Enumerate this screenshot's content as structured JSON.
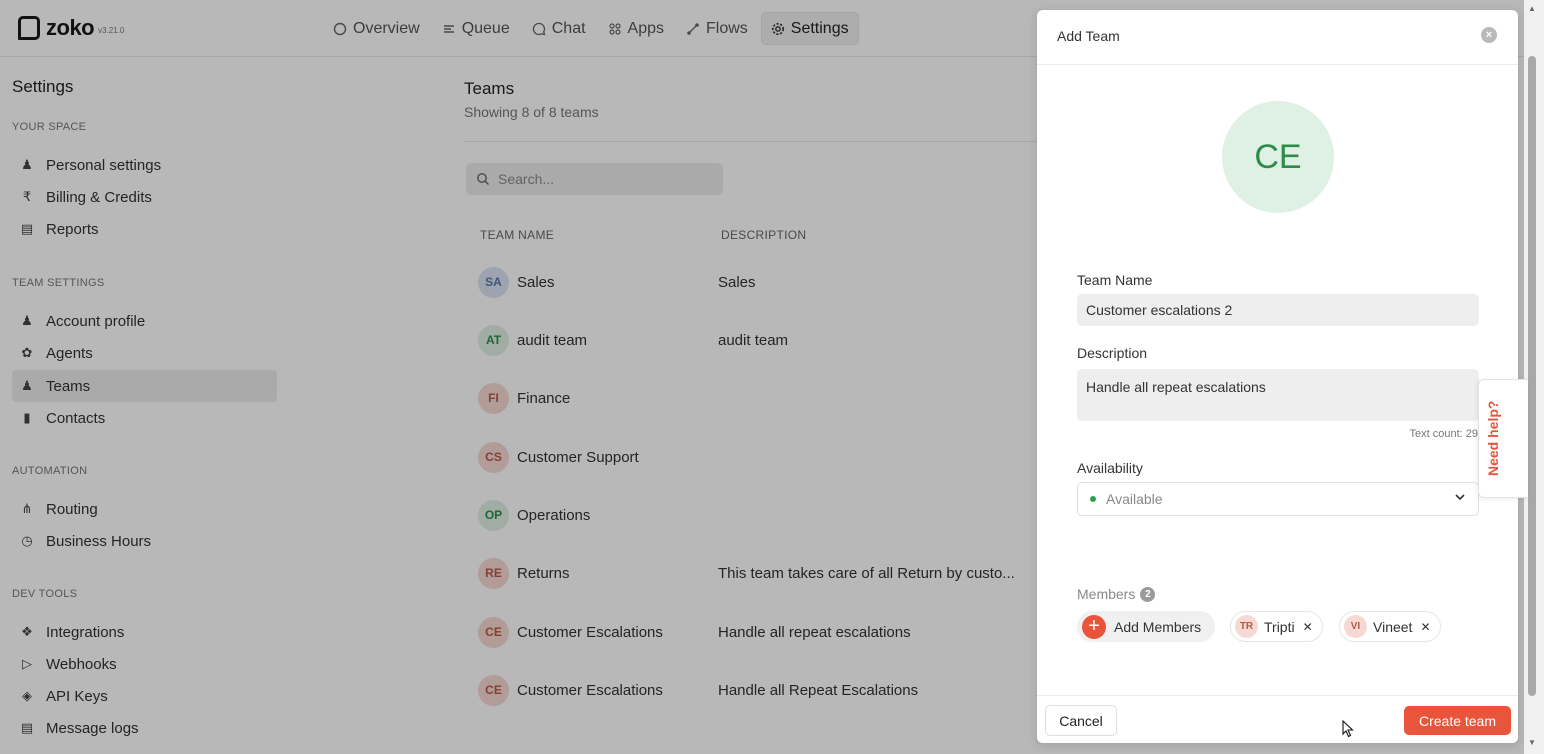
{
  "brand": {
    "name": "zoko",
    "version": "v3.21.0"
  },
  "nav": [
    {
      "label": "Overview",
      "icon": "circle-icon"
    },
    {
      "label": "Queue",
      "icon": "list-icon"
    },
    {
      "label": "Chat",
      "icon": "chat-icon"
    },
    {
      "label": "Apps",
      "icon": "grid-icon"
    },
    {
      "label": "Flows",
      "icon": "flow-icon"
    },
    {
      "label": "Settings",
      "icon": "gear-icon",
      "active": true
    }
  ],
  "sidebar": {
    "title": "Settings",
    "sections": {
      "your_space": "YOUR SPACE",
      "team_settings": "TEAM SETTINGS",
      "automation": "AUTOMATION",
      "dev_tools": "DEV TOOLS"
    },
    "items": {
      "personal": "Personal settings",
      "billing": "Billing & Credits",
      "reports": "Reports",
      "account": "Account profile",
      "agents": "Agents",
      "teams": "Teams",
      "contacts": "Contacts",
      "routing": "Routing",
      "hours": "Business Hours",
      "integrations": "Integrations",
      "webhooks": "Webhooks",
      "api": "API Keys",
      "logs": "Message logs"
    }
  },
  "teams": {
    "title": "Teams",
    "subtitle": "Showing 8 of 8 teams",
    "search_placeholder": "Search...",
    "columns": {
      "name": "TEAM NAME",
      "description": "DESCRIPTION"
    },
    "rows": [
      {
        "initials": "SA",
        "name": "Sales",
        "description": "Sales"
      },
      {
        "initials": "AT",
        "name": "audit team",
        "description": "audit team"
      },
      {
        "initials": "FI",
        "name": "Finance",
        "description": ""
      },
      {
        "initials": "CS",
        "name": "Customer Support",
        "description": ""
      },
      {
        "initials": "OP",
        "name": "Operations",
        "description": ""
      },
      {
        "initials": "RE",
        "name": "Returns",
        "description": "This team takes care of all Return by custo..."
      },
      {
        "initials": "CE",
        "name": "Customer Escalations",
        "description": "Handle all repeat escalations"
      },
      {
        "initials": "CE",
        "name": "Customer Escalations",
        "description": "Handle all Repeat Escalations"
      }
    ]
  },
  "modal": {
    "title": "Add Team",
    "avatar_initials": "CE",
    "team_name_label": "Team Name",
    "team_name_value": "Customer escalations 2",
    "description_label": "Description",
    "description_value": "Handle all repeat escalations",
    "text_count": "Text count: 29",
    "availability_label": "Availability",
    "availability_value": "Available",
    "members_label": "Members",
    "members_count": "2",
    "add_members_label": "Add Members",
    "members": [
      {
        "initials": "TR",
        "name": "Tripti"
      },
      {
        "initials": "VI",
        "name": "Vineet"
      }
    ],
    "cancel_label": "Cancel",
    "create_label": "Create team"
  },
  "help_tab": "Need help?",
  "colors": {
    "accent": "#e8553a",
    "avatar_bg": "#dff0e4",
    "avatar_text": "#2e8c4b",
    "status_available": "#2e9e52"
  }
}
